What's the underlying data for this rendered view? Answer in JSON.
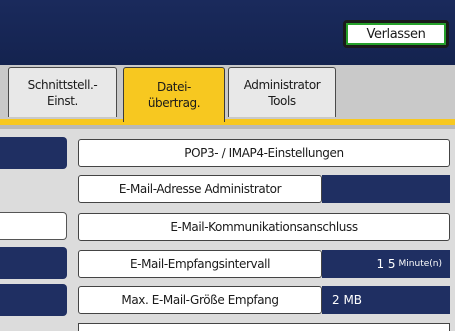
{
  "header": {
    "exit_label": "Verlassen"
  },
  "tabs": [
    {
      "line1": "Schnittstell.-",
      "line2": "Einst.",
      "active": false
    },
    {
      "line1": "Datei-",
      "line2": "übertrag.",
      "active": true
    },
    {
      "line1": "Administrator",
      "line2": "Tools",
      "active": false
    }
  ],
  "settings": {
    "pop3_imap4": "POP3- / IMAP4-Einstellungen",
    "admin_email": "E-Mail-Adresse Administrator",
    "admin_email_value": "",
    "comm_port": "E-Mail-Kommunikationsanschluss",
    "receive_interval": "E-Mail-Empfangsintervall",
    "receive_interval_value": "1 5",
    "receive_interval_unit": "Minute(n)",
    "max_receive_size": "Max. E-Mail-Größe Empfang",
    "max_receive_size_value": "2 MB"
  },
  "colors": {
    "accent": "#f7c820",
    "header": "#1a2a5c",
    "value_bg": "#1f2f62"
  }
}
